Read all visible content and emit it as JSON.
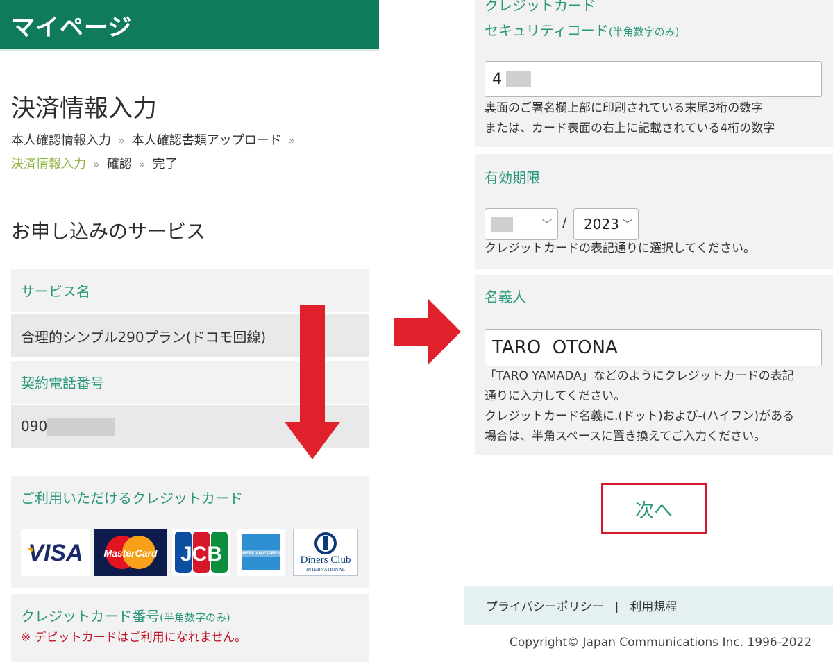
{
  "header": {
    "title": "マイページ"
  },
  "page": {
    "title": "決済情報入力",
    "breadcrumb": [
      "本人確認情報入力",
      "本人確認書類アップロード",
      "決済情報入力",
      "確認",
      "完了"
    ],
    "breadcrumb_sep": "»"
  },
  "service": {
    "section_title": "お申し込みのサービス",
    "name_label": "サービス名",
    "name_value": "合理的シンプル290プラン(ドコモ回線)",
    "phone_label": "契約電話番号",
    "phone_prefix": "090"
  },
  "cards": {
    "label": "ご利用いただけるクレジットカード",
    "brands": [
      "VISA",
      "MasterCard",
      "JCB",
      "AMERICAN EXPRESS",
      "Diners Club",
      "INTERNATIONAL"
    ]
  },
  "card_number": {
    "label": "クレジットカード番号",
    "label_note": "(半角数字のみ)",
    "warning": "※ デビットカードはご利用になれません。"
  },
  "security": {
    "label_line1": "クレジットカード",
    "label_line2": "セキュリティコード",
    "label_note": "(半角数字のみ)",
    "value_prefix": "4",
    "help_line1": "裏面のご署名欄上部に印刷されている末尾3桁の数字",
    "help_line2": "または、カード表面の右上に記載されている4桁の数字"
  },
  "expiry": {
    "label": "有効期限",
    "slash": "/",
    "year": "2023",
    "help": "クレジットカードの表記通りに選択してください。"
  },
  "holder": {
    "label": "名義人",
    "value": "TARO  OTONA",
    "help_line1": "「TARO YAMADA」などのようにクレジットカードの表記",
    "help_line2": "通りに入力してください。",
    "help_line3": "クレジットカード名義に.(ドット)および-(ハイフン)がある",
    "help_line4": "場合は、半角スペースに置き換えてご入力ください。"
  },
  "next_button": "次へ",
  "footer": {
    "privacy": "プライバシーポリシー",
    "separator": "|",
    "terms": "利用規程",
    "copyright": "Copyright© Japan Communications Inc. 1996-2022"
  },
  "colors": {
    "header_green": "#0f7a5c",
    "label_green": "#27967a",
    "crumb_active": "#8db440",
    "warning_red": "#c0142a",
    "arrow_red": "#e0202a"
  }
}
